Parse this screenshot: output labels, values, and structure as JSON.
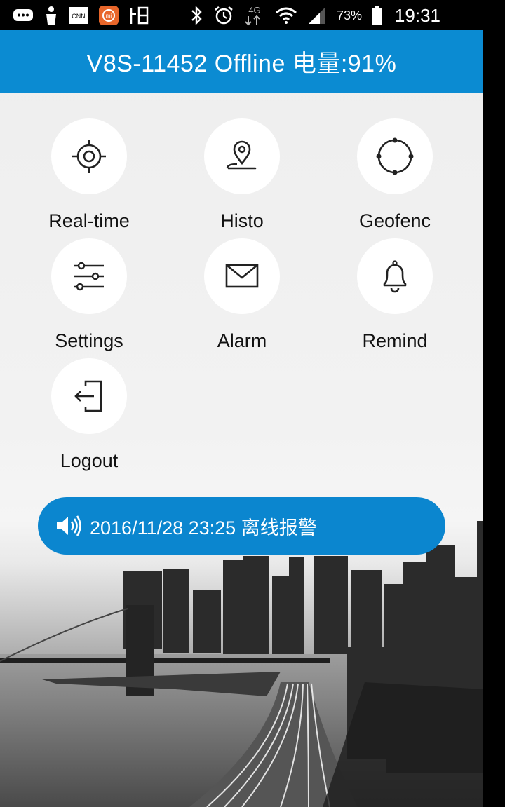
{
  "status_bar": {
    "icons": [
      "chat-icon",
      "hand-icon",
      "cnn-icon",
      "mi-icon",
      "app-icon",
      "bluetooth-icon",
      "alarm-icon",
      "4g-icon",
      "wifi-icon",
      "signal-icon",
      "battery-icon"
    ],
    "network_label": "4G",
    "battery_percent": "73%",
    "time": "19:31"
  },
  "header": {
    "title": "V8S-11452 Offline 电量:91%"
  },
  "menu": {
    "items": [
      {
        "label": "Real-time",
        "icon": "crosshair-icon"
      },
      {
        "label": "Histo",
        "icon": "map-pin-icon"
      },
      {
        "label": "Geofenc",
        "icon": "geofence-icon"
      },
      {
        "label": "Settings",
        "icon": "sliders-icon"
      },
      {
        "label": "Alarm",
        "icon": "envelope-icon"
      },
      {
        "label": "Remind",
        "icon": "bell-icon"
      },
      {
        "label": "Logout",
        "icon": "logout-icon"
      }
    ]
  },
  "notice": {
    "icon": "speaker-icon",
    "text": "2016/11/28 23:25 离线报警"
  },
  "colors": {
    "primary": "#0b8bd2",
    "notice_bg": "#0b86cf",
    "circle_bg": "#ffffff",
    "text": "#111111"
  }
}
